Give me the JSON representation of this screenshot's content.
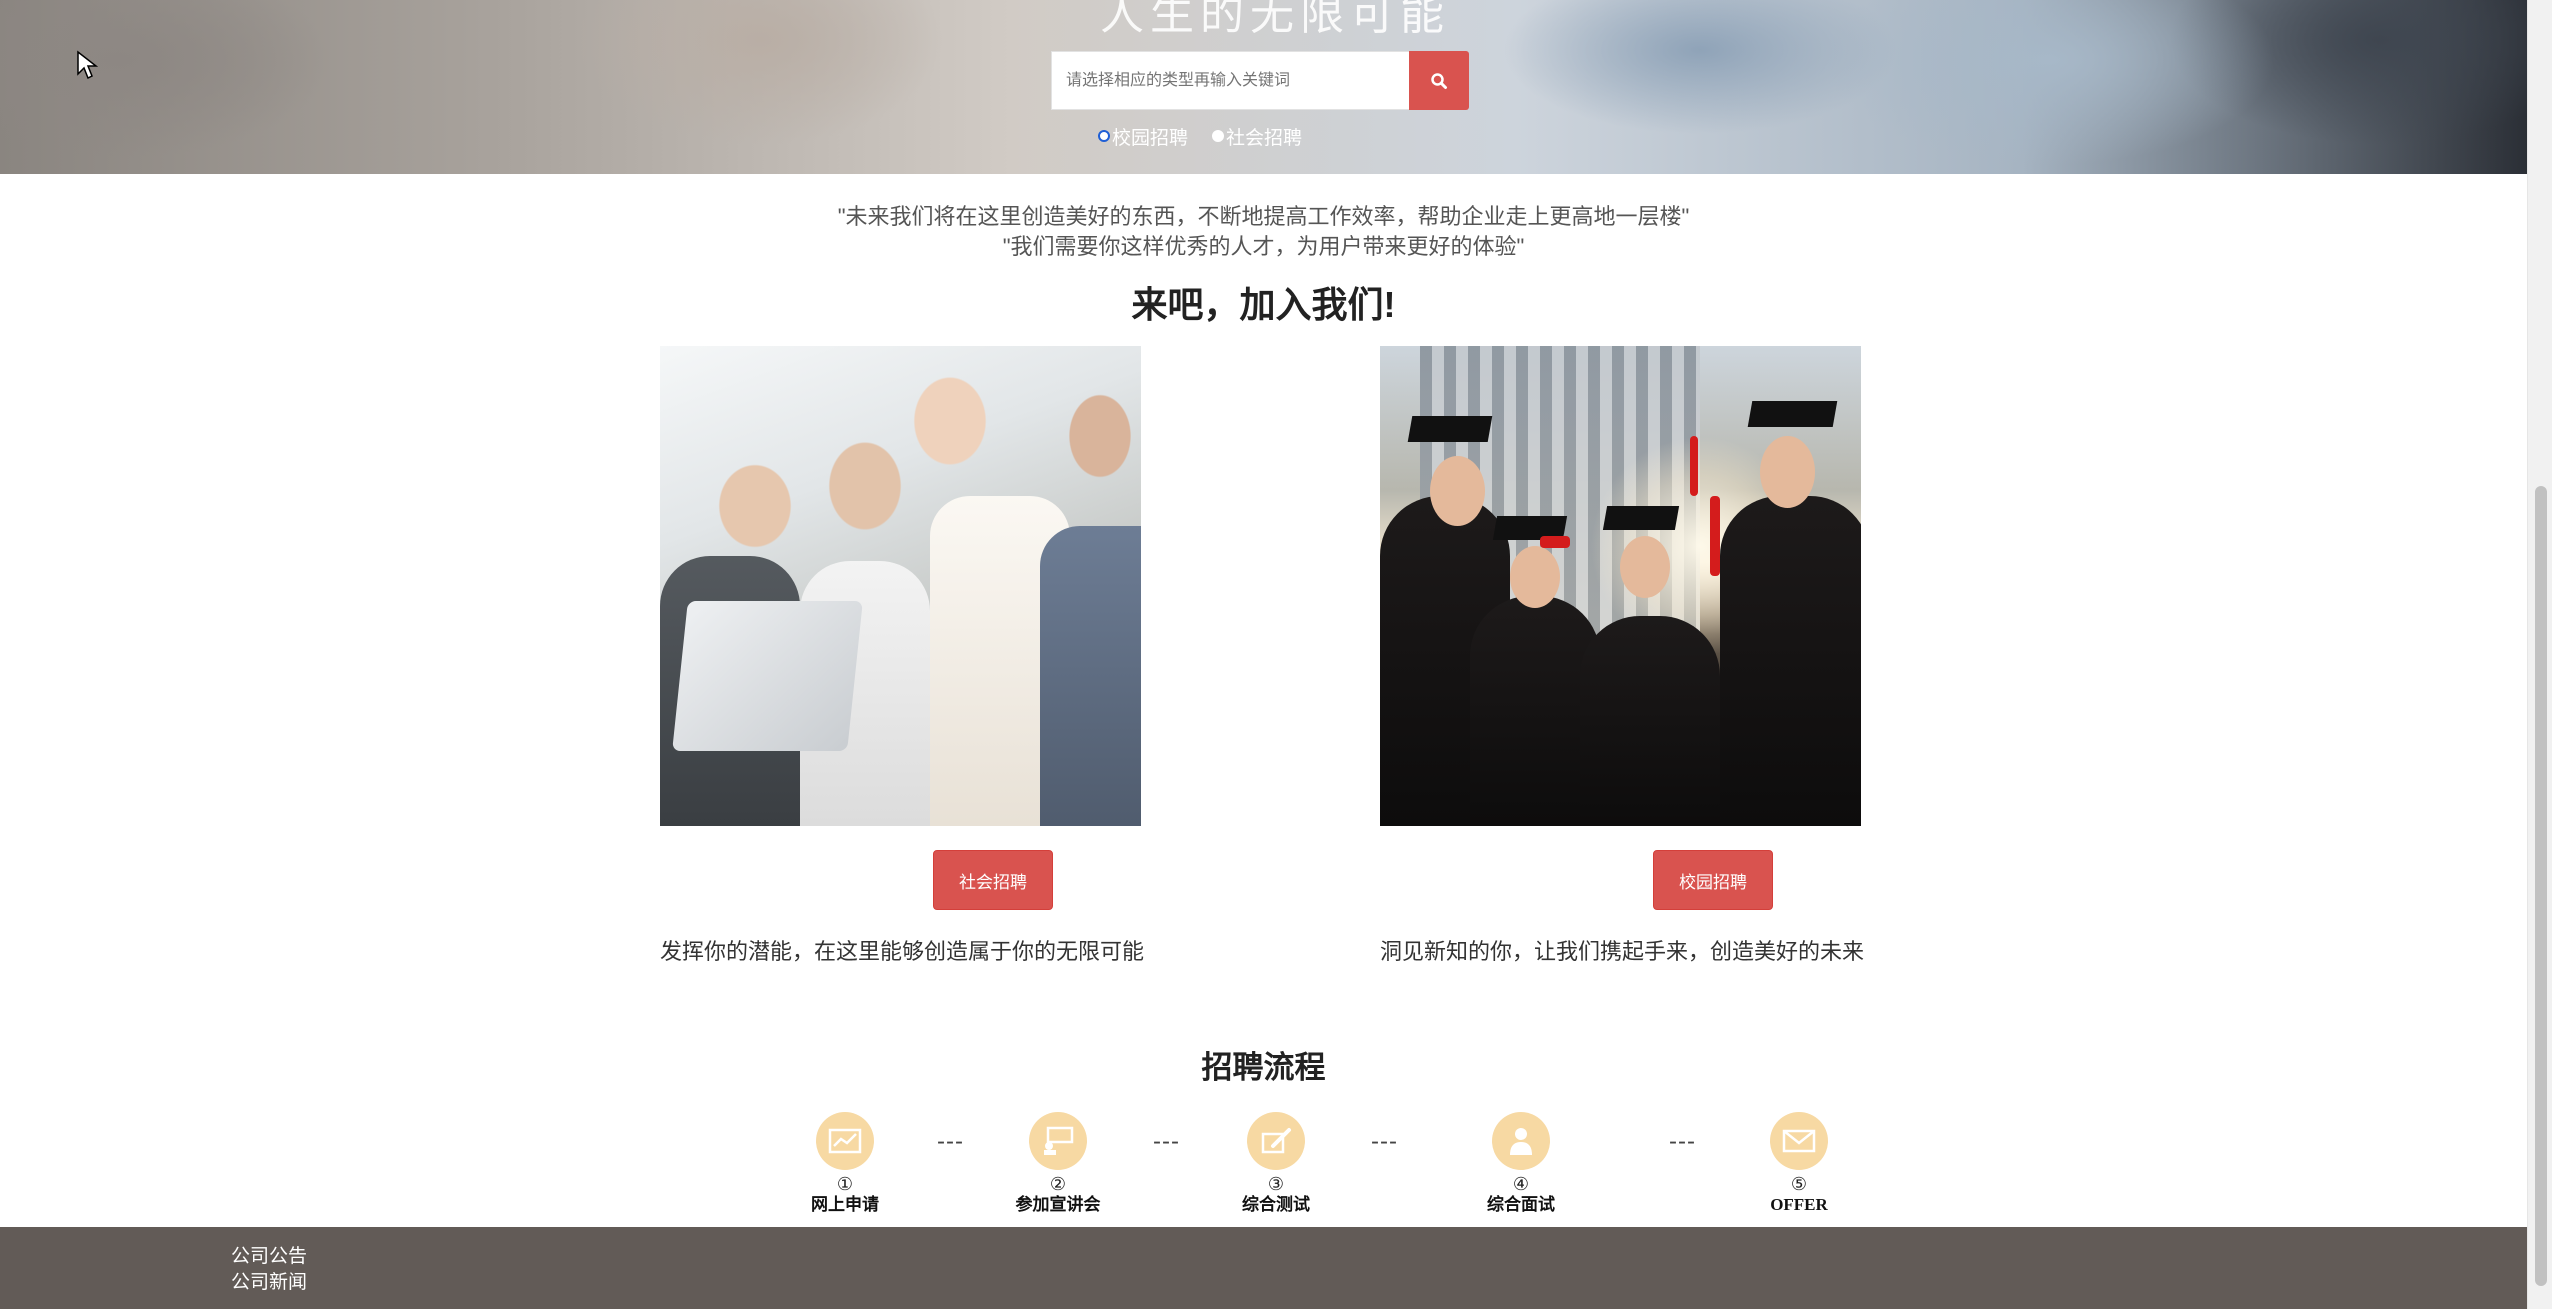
{
  "hero": {
    "title": "人生的无限可能",
    "search_placeholder": "请选择相应的类型再输入关键词",
    "search_icon": "search-icon",
    "radio_options": [
      {
        "label": "校园招聘",
        "checked": true
      },
      {
        "label": "社会招聘",
        "checked": false
      }
    ]
  },
  "slogan": {
    "line1": "\"未来我们将在这里创造美好的东西，不断地提高工作效率，帮助企业走上更高地一层楼\"",
    "line2": "\"我们需要你这样优秀的人才，为用户带来更好的体验\""
  },
  "join": {
    "title": "来吧，加入我们!"
  },
  "cards": [
    {
      "button_label": "社会招聘",
      "caption": "发挥你的潜能，在这里能够创造属于你的无限可能"
    },
    {
      "button_label": "校园招聘",
      "caption": "洞见新知的你，让我们携起手来，创造美好的未来"
    }
  ],
  "process": {
    "title": "招聘流程",
    "separator": "---",
    "steps": [
      {
        "num": "①",
        "label": "网上申请",
        "icon": "chart-icon"
      },
      {
        "num": "②",
        "label": "参加宣讲会",
        "icon": "presentation-icon"
      },
      {
        "num": "③",
        "label": "综合测试",
        "icon": "test-pen-icon"
      },
      {
        "num": "④",
        "label": "综合面试",
        "icon": "interview-person-icon"
      },
      {
        "num": "⑤",
        "label": "OFFER",
        "icon": "envelope-icon"
      }
    ]
  },
  "footer": {
    "links": [
      "公司公告",
      "公司新闻"
    ]
  },
  "colors": {
    "accent": "#d9534f",
    "footer_bg": "#625b57",
    "step_icon_bg": "#f7d9a3"
  }
}
